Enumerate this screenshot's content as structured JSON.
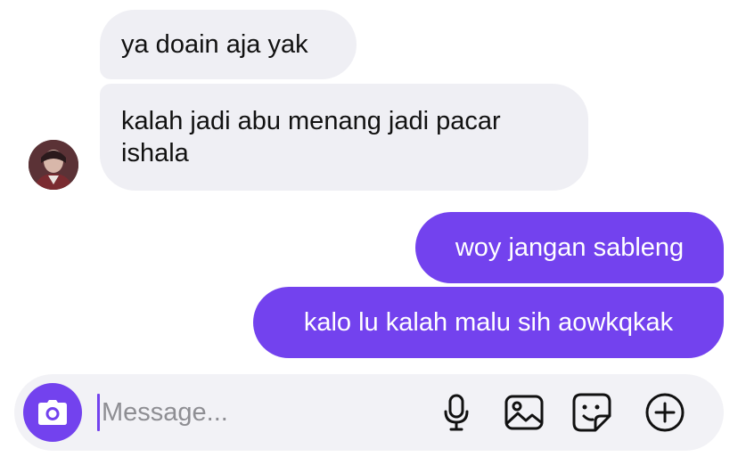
{
  "conversation": {
    "messages": [
      {
        "direction": "incoming",
        "text": "ya doain aja yak"
      },
      {
        "direction": "incoming",
        "text": "kalah jadi abu menang jadi pacar ishala"
      },
      {
        "direction": "outgoing",
        "text": "woy jangan sableng"
      },
      {
        "direction": "outgoing",
        "text": "kalo lu kalah malu sih aowkqkak"
      }
    ]
  },
  "composer": {
    "placeholder": "Message...",
    "value": "",
    "icons": [
      "camera-icon",
      "microphone-icon",
      "image-icon",
      "sticker-icon",
      "plus-icon"
    ]
  },
  "colors": {
    "accent": "#7342ee",
    "incoming_bubble": "#efeff4",
    "composer_bg": "#f2f2f6"
  }
}
